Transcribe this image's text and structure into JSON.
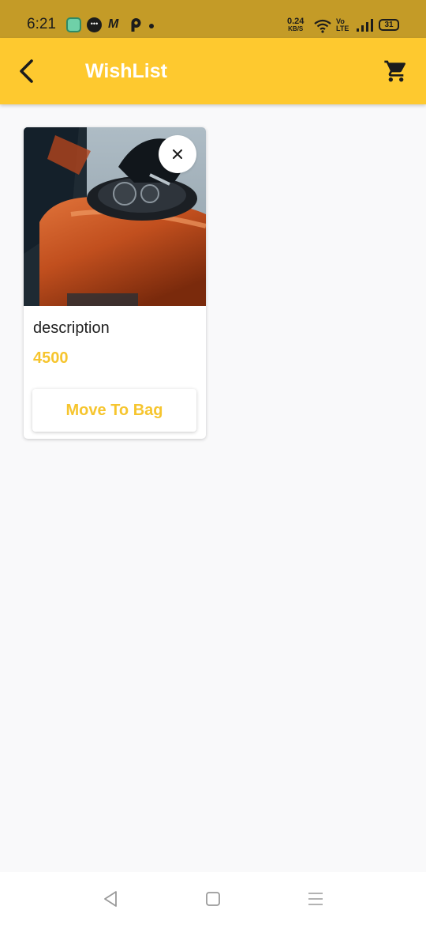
{
  "status_bar": {
    "time": "6:21",
    "notification_icons": [
      "app-icon",
      "chat-icon",
      "m-icon",
      "p-icon",
      "dot-icon"
    ],
    "m_glyph": "M",
    "chat_glyph": "•••",
    "network_speed": "0.24",
    "network_speed_unit": "KB/S",
    "volte_top": "Vo",
    "volte_bottom": "LTE",
    "battery": "31"
  },
  "app_bar": {
    "title": "WishList",
    "back_icon": "chevron-left-icon",
    "cart_icon": "shopping-cart-icon",
    "background": "#fec92f"
  },
  "wishlist": {
    "items": [
      {
        "image": "motorcycle-fuel-tank-photo",
        "description": "description",
        "price": "4500",
        "remove_icon": "close-icon",
        "action_label": "Move To Bag"
      }
    ]
  },
  "nav_bar": {
    "icons": [
      "nav-back-icon",
      "nav-home-icon",
      "nav-menu-icon"
    ]
  },
  "colors": {
    "status_bar": "#c49b27",
    "accent": "#fec92f",
    "price_text": "#f6c52e",
    "page_background": "#f9f9fa"
  }
}
